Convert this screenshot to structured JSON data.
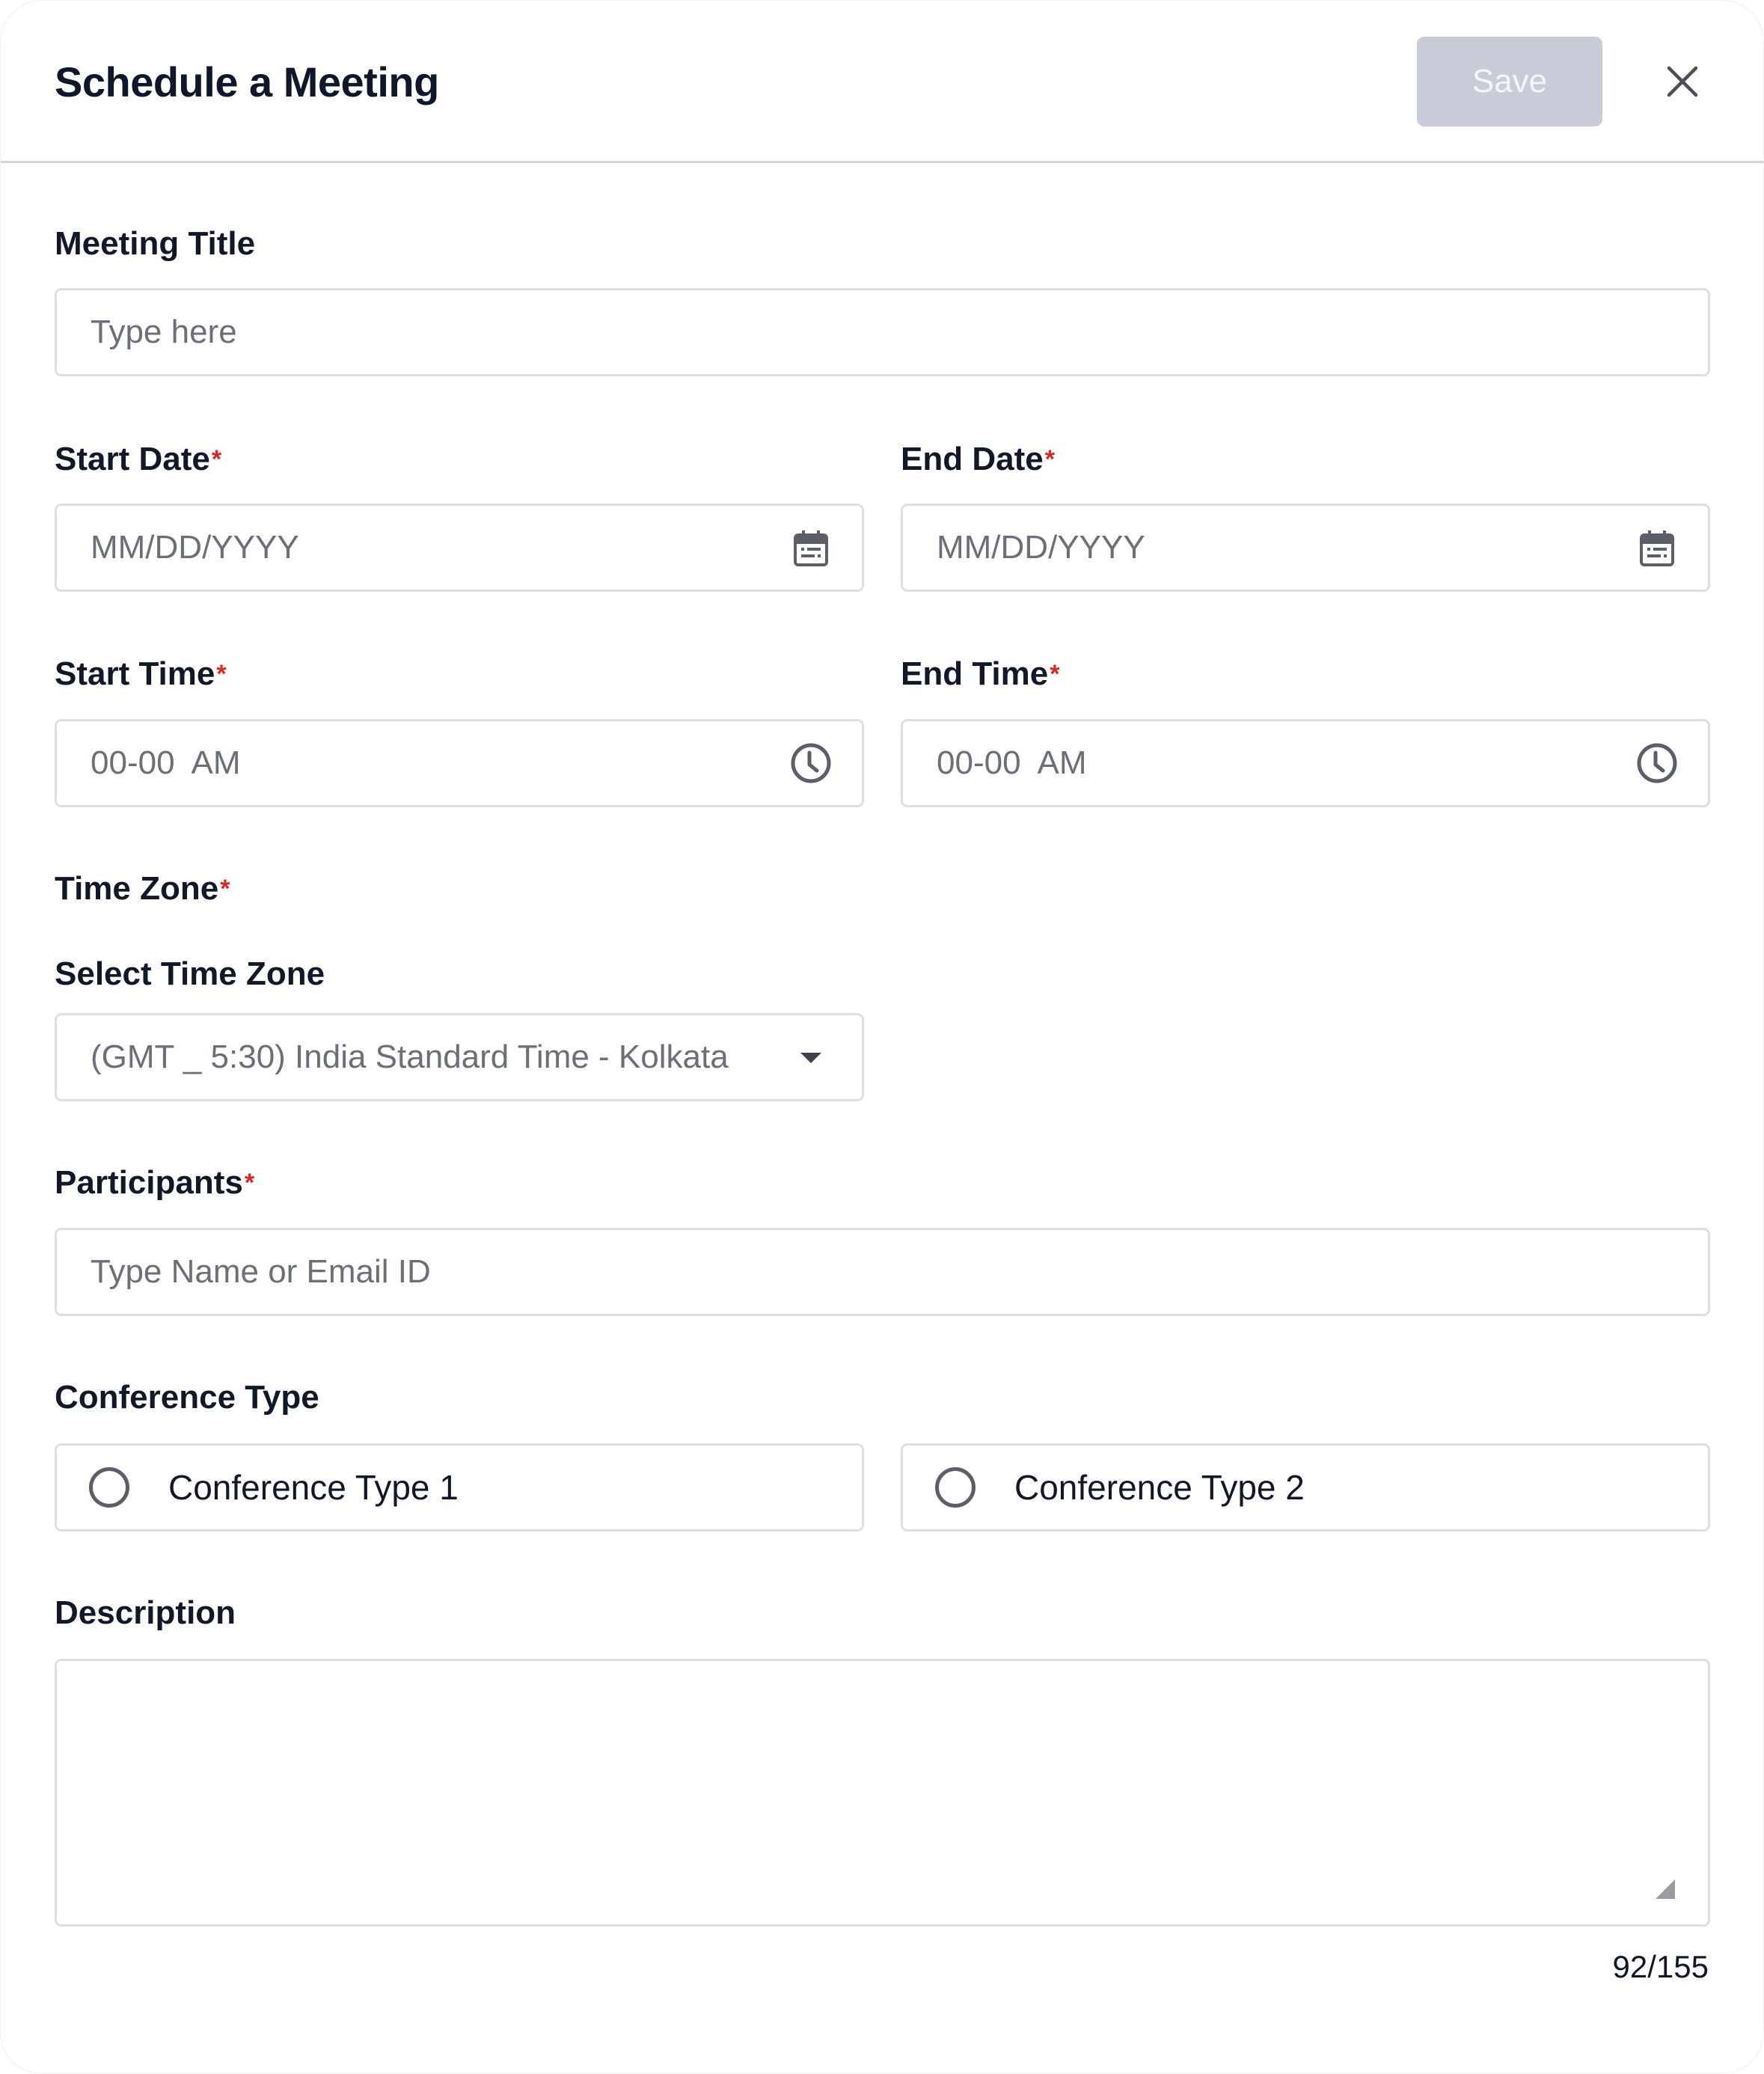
{
  "dialog": {
    "title": "Schedule a Meeting",
    "save_label": "Save",
    "save_disabled": true,
    "close_icon": "close-icon"
  },
  "colors": {
    "required_marker": "#e02424",
    "save_disabled_bg": "#c9ccd8",
    "border": "#dfe0e4",
    "text": "#111827",
    "placeholder": "#6b6f78"
  },
  "form": {
    "meeting_title": {
      "label": "Meeting Title",
      "placeholder": "Type here",
      "value": ""
    },
    "start_date": {
      "label": "Start Date",
      "required_marker": "*",
      "placeholder": "MM/DD/YYYY",
      "icon": "calendar-icon"
    },
    "end_date": {
      "label": "End Date",
      "required_marker": "*",
      "placeholder": "MM/DD/YYYY",
      "icon": "calendar-icon"
    },
    "start_time": {
      "label": "Start Time",
      "required_marker": "*",
      "placeholder": "00-00  AM",
      "icon": "clock-icon"
    },
    "end_time": {
      "label": "End Time",
      "required_marker": "*",
      "placeholder": "00-00  AM",
      "icon": "clock-icon"
    },
    "time_zone": {
      "label": "Time Zone",
      "required_marker": "*",
      "select_label": "Select Time Zone",
      "selected": "(GMT _ 5:30) India Standard Time - Kolkata",
      "icon": "caret-down-icon"
    },
    "participants": {
      "label": "Participants",
      "required_marker": "*",
      "placeholder": "Type Name or Email ID"
    },
    "conference_type": {
      "label": "Conference Type",
      "options": [
        {
          "label": "Conference Type 1",
          "selected": false
        },
        {
          "label": "Conference Type 2",
          "selected": false
        }
      ]
    },
    "description": {
      "label": "Description",
      "value": "",
      "counter": "92/155"
    }
  }
}
